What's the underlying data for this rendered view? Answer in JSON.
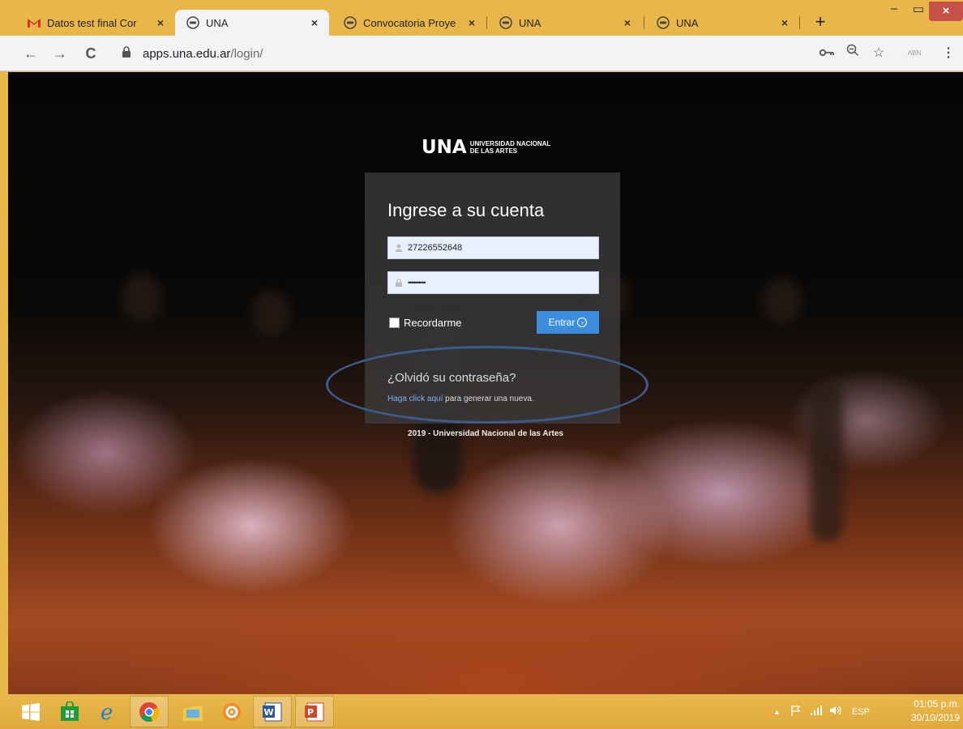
{
  "browser": {
    "tabs": [
      {
        "title": "Datos test final Cor",
        "icon": "gmail-icon",
        "active": false
      },
      {
        "title": "UNA",
        "icon": "una-favicon-icon",
        "active": true
      },
      {
        "title": "Convocatoria Proye",
        "icon": "una-favicon-icon",
        "active": false
      },
      {
        "title": "UNA",
        "icon": "una-favicon-icon",
        "active": false
      },
      {
        "title": "UNA",
        "icon": "una-favicon-icon",
        "active": false
      }
    ],
    "new_tab": "+",
    "window_controls": {
      "minimize": "–",
      "maximize": "▭",
      "close": "×"
    },
    "url_host": "apps.una.edu.ar",
    "url_path": "/login/",
    "nav": {
      "back": "←",
      "forward": "→",
      "reload": "C"
    },
    "toolbar_icons": [
      "key-icon",
      "zoom-icon",
      "bookmark-star-icon",
      "extension-icon",
      "menu-icon"
    ]
  },
  "page": {
    "logo_mark": "UNA",
    "logo_line1": "UNIVERSIDAD NACIONAL",
    "logo_line2": "DE LAS ARTES",
    "login": {
      "title": "Ingrese a su cuenta",
      "username_value": "27226552648",
      "password_value": "••••••••••",
      "remember_label": "Recordarme",
      "remember_checked": false,
      "submit_label": "Entrar"
    },
    "forgot": {
      "title": "¿Olvidó su contraseña?",
      "link_text": "Haga click aquí",
      "rest_text": " para generar una nueva."
    },
    "footer": "2019 - Universidad Nacional de las Artes"
  },
  "taskbar": {
    "items": [
      "start-icon",
      "store-icon",
      "ie-icon",
      "chrome-icon",
      "file-explorer-icon",
      "settings-app-icon",
      "word-icon",
      "powerpoint-icon"
    ],
    "language": "ESP",
    "time": "01:05 p.m.",
    "date": "30/10/2019"
  },
  "colors": {
    "tab_strip": "#e9b64a",
    "login_button": "#3c8dde",
    "annotation_ellipse": "#3b5c8c"
  }
}
